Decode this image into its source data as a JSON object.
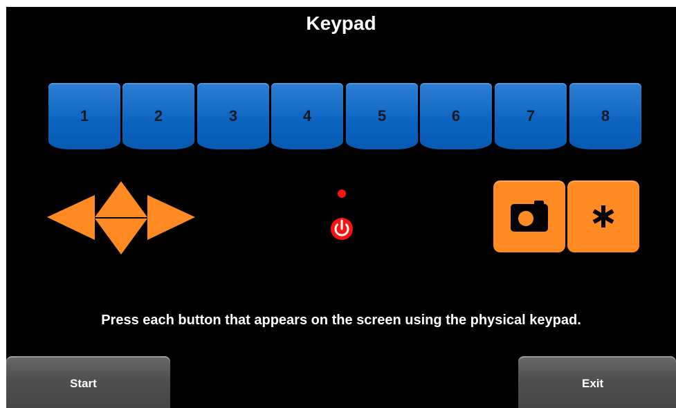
{
  "header": {
    "title": "Keypad"
  },
  "number_keys": [
    {
      "label": "1"
    },
    {
      "label": "2"
    },
    {
      "label": "3"
    },
    {
      "label": "4"
    },
    {
      "label": "5"
    },
    {
      "label": "6"
    },
    {
      "label": "7"
    },
    {
      "label": "8"
    }
  ],
  "navigation": {
    "icons": [
      "arrow-left-icon",
      "arrow-up-icon",
      "arrow-down-icon",
      "arrow-right-icon"
    ]
  },
  "power": {
    "indicator_icon": "led-indicator-icon",
    "button_icon": "power-icon"
  },
  "function_keys": {
    "camera_icon": "camera-icon",
    "star_label": "*"
  },
  "instructions": "Press each button that appears on the screen using the physical keypad.",
  "footer": {
    "start_label": "Start",
    "exit_label": "Exit"
  },
  "colors": {
    "background": "#000000",
    "number_key": "#0a63c0",
    "orange_key": "#ff8a22",
    "power_red": "#ff1010",
    "softkey_gray": "#505050"
  }
}
